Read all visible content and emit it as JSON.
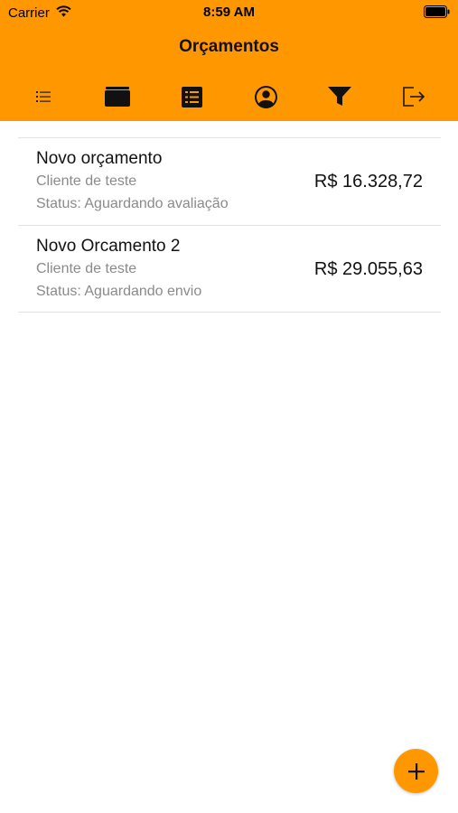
{
  "status_bar": {
    "carrier": "Carrier",
    "time": "8:59 AM"
  },
  "nav": {
    "title": "Orçamentos"
  },
  "toolbar": {
    "buttons": [
      {
        "name": "list-icon"
      },
      {
        "name": "folder-icon"
      },
      {
        "name": "document-list-icon"
      },
      {
        "name": "user-icon"
      },
      {
        "name": "filter-icon"
      },
      {
        "name": "logout-icon"
      }
    ]
  },
  "budgets": [
    {
      "title": "Novo orçamento",
      "client": "Cliente de teste",
      "status": "Status: Aguardando avaliação",
      "value": "R$ 16.328,72"
    },
    {
      "title": "Novo Orcamento 2",
      "client": "Cliente de teste",
      "status": "Status: Aguardando envio",
      "value": "R$ 29.055,63"
    }
  ],
  "fab": {
    "icon": "plus-icon"
  },
  "colors": {
    "accent": "#FF9800",
    "text": "#111111",
    "secondary_text": "#8A8A8A",
    "divider": "#E2E2E2"
  }
}
